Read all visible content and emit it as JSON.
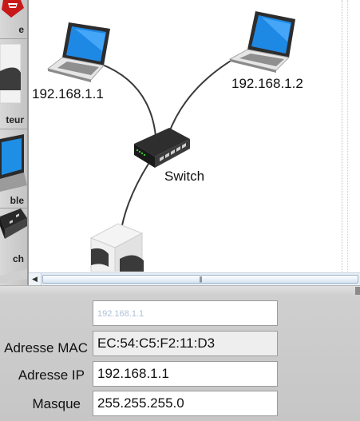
{
  "palette": {
    "items": [
      {
        "label": "e",
        "icon": "red-device-icon"
      },
      {
        "label": "teur",
        "icon": "computer-tower-icon"
      },
      {
        "label": "ble",
        "icon": "laptop-icon"
      },
      {
        "label": "ch",
        "icon": "switch-icon"
      }
    ]
  },
  "canvas": {
    "nodes": [
      {
        "type": "laptop",
        "label": "192.168.1.1",
        "icon": "laptop-icon"
      },
      {
        "type": "laptop",
        "label": "192.168.1.2",
        "icon": "laptop-icon"
      },
      {
        "type": "switch",
        "label": "Switch",
        "icon": "switch-icon"
      },
      {
        "type": "server",
        "label": "",
        "icon": "server-icon"
      }
    ]
  },
  "scrollbar": {
    "grip": "|||"
  },
  "properties": {
    "name_value": "192.168.1.1",
    "mac_label": "Adresse MAC",
    "mac_value": "EC:54:C5:F2:11:D3",
    "ip_label": "Adresse IP",
    "ip_value": "192.168.1.1",
    "mask_label": "Masque",
    "mask_value": "255.255.255.0"
  },
  "colors": {
    "accent": "#3fa3ff",
    "panel": "#c9c9c9",
    "link": "#3a3a3a"
  }
}
